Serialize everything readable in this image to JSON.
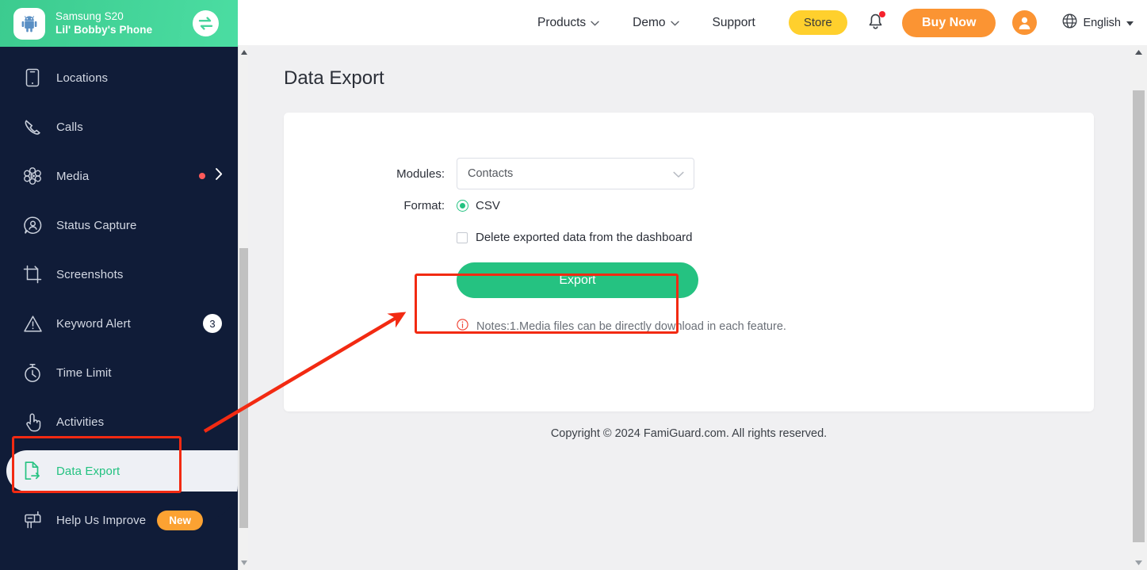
{
  "device": {
    "avatar_icon": "android-robot-icon",
    "model": "Samsung S20",
    "nickname": "Lil' Bobby's Phone",
    "switch_icon": "switch-device-icon"
  },
  "sidebar": {
    "items": [
      {
        "id": "locations",
        "label": "Locations",
        "icon": "phone-outline-icon",
        "active": false
      },
      {
        "id": "calls",
        "label": "Calls",
        "icon": "phone-call-icon",
        "active": false
      },
      {
        "id": "media",
        "label": "Media",
        "icon": "media-flower-icon",
        "active": false,
        "dot": true,
        "chevron": true
      },
      {
        "id": "status-capture",
        "label": "Status Capture",
        "icon": "status-capture-icon",
        "active": false
      },
      {
        "id": "screenshots",
        "label": "Screenshots",
        "icon": "crop-frame-icon",
        "active": false
      },
      {
        "id": "keyword-alert",
        "label": "Keyword Alert",
        "icon": "warning-triangle-icon",
        "active": false,
        "count": "3"
      },
      {
        "id": "time-limit",
        "label": "Time Limit",
        "icon": "stopwatch-icon",
        "active": false
      },
      {
        "id": "activities",
        "label": "Activities",
        "icon": "hand-tap-icon",
        "active": false
      },
      {
        "id": "data-export",
        "label": "Data Export",
        "icon": "file-export-icon",
        "active": true
      },
      {
        "id": "help-improve",
        "label": "Help Us Improve",
        "icon": "mailbox-icon",
        "active": false,
        "badge": "New"
      }
    ]
  },
  "topbar": {
    "links": [
      {
        "id": "products",
        "label": "Products",
        "caret": true
      },
      {
        "id": "demo",
        "label": "Demo",
        "caret": true
      },
      {
        "id": "support",
        "label": "Support",
        "caret": false
      }
    ],
    "store_label": "Store",
    "buy_now_label": "Buy Now",
    "bell_icon": "notification-bell-icon",
    "avatar_icon": "user-avatar-icon",
    "globe_icon": "globe-icon",
    "language": "English"
  },
  "main": {
    "title": "Data Export",
    "modules_label": "Modules:",
    "modules_value": "Contacts",
    "modules_caret_icon": "chevron-down-icon",
    "format_label": "Format:",
    "format_value": "CSV",
    "delete_label": "Delete exported data from the dashboard",
    "delete_checked": false,
    "export_label": "Export",
    "notes_icon": "info-circle-icon",
    "notes_text": "Notes:1.Media files can be directly download in each feature.",
    "copyright": "Copyright © 2024 FamiGuard.com. All rights reserved."
  },
  "colors": {
    "brand_green": "#25c281",
    "sidebar_navy": "#101c38",
    "accent_orange": "#fb9433",
    "store_yellow": "#ffd02d",
    "annotation_red": "#f22a12",
    "badge_red": "#ff5a5a"
  },
  "annotations": {
    "highlight_sidebar_item": "data-export",
    "highlight_button": "Export",
    "arrow": "points from Data Export sidebar item to Export button"
  }
}
